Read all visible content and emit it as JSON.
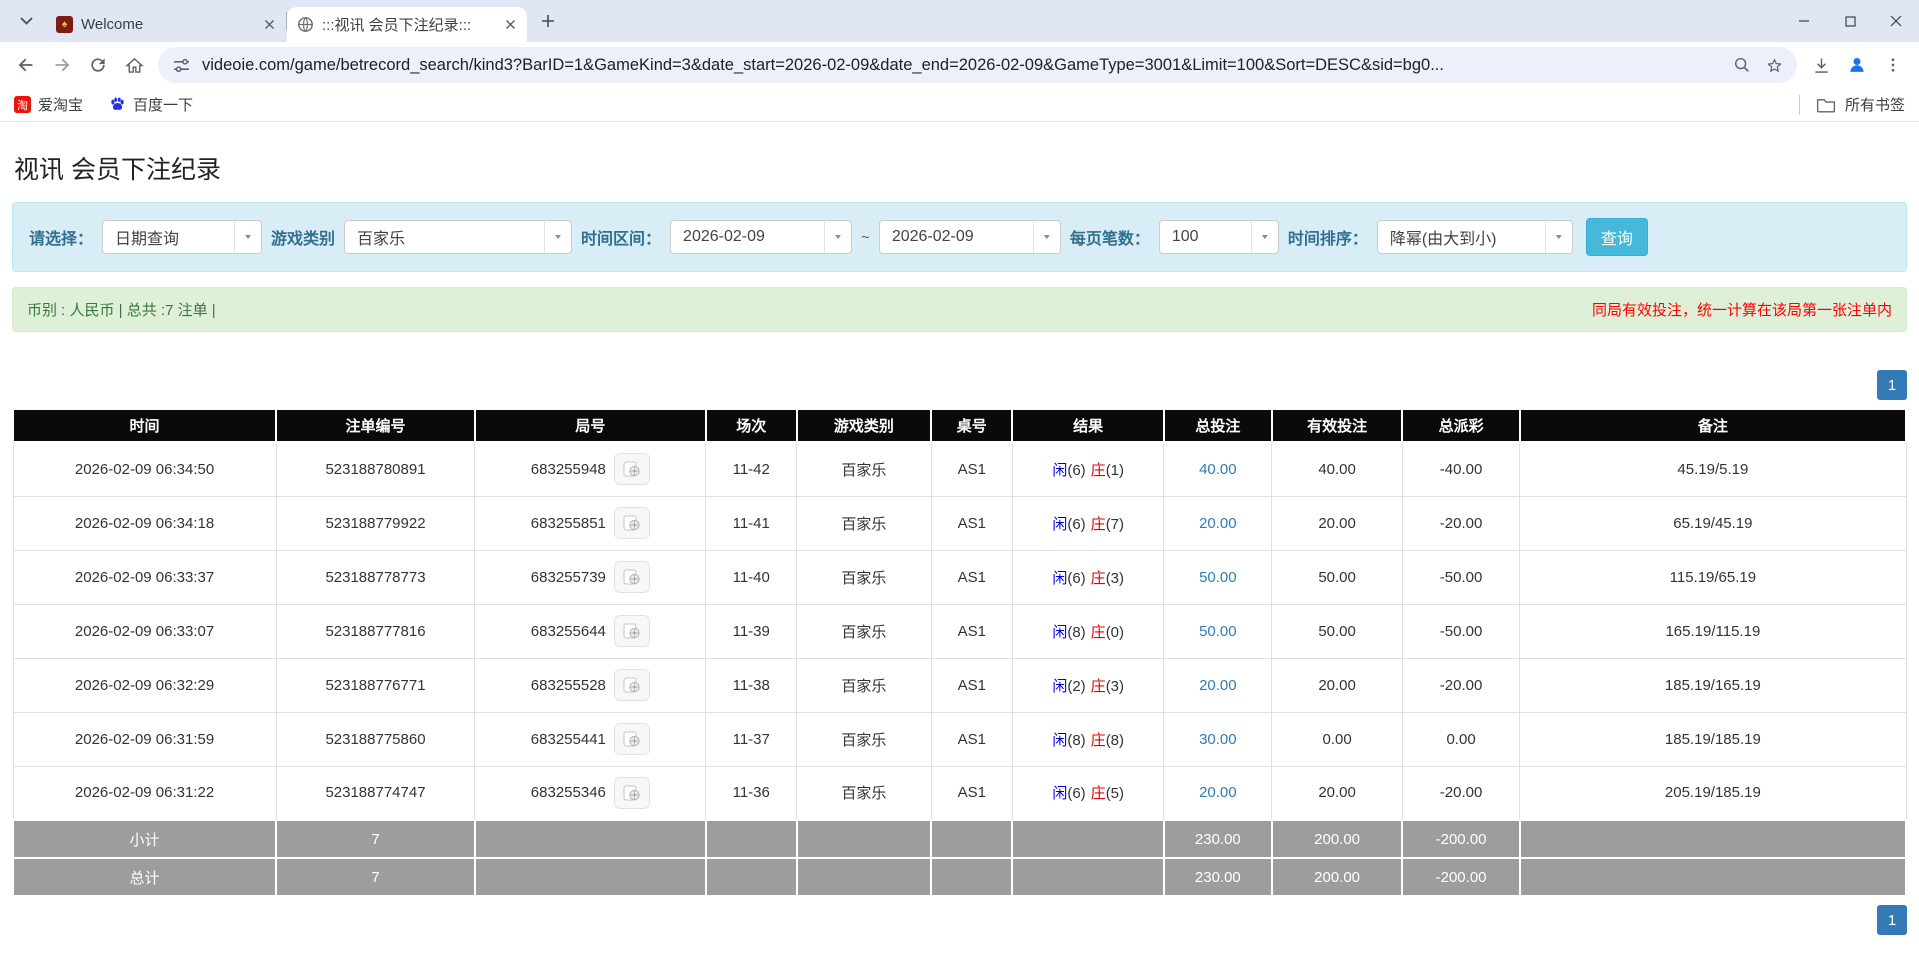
{
  "browser": {
    "tabs": [
      {
        "title": "Welcome"
      },
      {
        "title": ":::视讯 会员下注纪录:::"
      }
    ],
    "url": "videoie.com/game/betrecord_search/kind3?BarID=1&GameKind=3&date_start=2026-02-09&date_end=2026-02-09&GameType=3001&Limit=100&Sort=DESC&sid=bg0...",
    "bookmarks": [
      {
        "label": "爱淘宝"
      },
      {
        "label": "百度一下"
      }
    ],
    "all_bookmarks_label": "所有书签"
  },
  "page": {
    "title": "视讯 会员下注纪录",
    "filters": {
      "query_label": "请选择：",
      "query_value": "日期查询",
      "game_label": "游戏类别",
      "game_value": "百家乐",
      "range_label": "时间区间：",
      "date_start": "2026-02-09",
      "range_sep": "~",
      "date_end": "2026-02-09",
      "per_page_label": "每页笔数：",
      "per_page_value": "100",
      "sort_label": "时间排序：",
      "sort_value": "降幂(由大到小)",
      "search_button": "查询"
    },
    "info_bar": {
      "left": "币别 : 人民币 | 总共 :7 注单 |",
      "right": "同局有效投注，统一计算在该局第一张注单内"
    },
    "pagination": "1",
    "table": {
      "headers": [
        "时间",
        "注单编号",
        "局号",
        "场次",
        "游戏类别",
        "桌号",
        "结果",
        "总投注",
        "有效投注",
        "总派彩",
        "备注"
      ],
      "rows": [
        {
          "time": "2026-02-09 06:34:50",
          "bet_id": "523188780891",
          "round_id": "683255948",
          "session": "11-42",
          "game": "百家乐",
          "table_no": "AS1",
          "player": "闲",
          "player_score": "(6)",
          "banker": "庄",
          "banker_score": "(1)",
          "total_bet": "40.00",
          "valid_bet": "40.00",
          "payout": "-40.00",
          "remark": "45.19/5.19"
        },
        {
          "time": "2026-02-09 06:34:18",
          "bet_id": "523188779922",
          "round_id": "683255851",
          "session": "11-41",
          "game": "百家乐",
          "table_no": "AS1",
          "player": "闲",
          "player_score": "(6)",
          "banker": "庄",
          "banker_score": "(7)",
          "total_bet": "20.00",
          "valid_bet": "20.00",
          "payout": "-20.00",
          "remark": "65.19/45.19"
        },
        {
          "time": "2026-02-09 06:33:37",
          "bet_id": "523188778773",
          "round_id": "683255739",
          "session": "11-40",
          "game": "百家乐",
          "table_no": "AS1",
          "player": "闲",
          "player_score": "(6)",
          "banker": "庄",
          "banker_score": "(3)",
          "total_bet": "50.00",
          "valid_bet": "50.00",
          "payout": "-50.00",
          "remark": "115.19/65.19"
        },
        {
          "time": "2026-02-09 06:33:07",
          "bet_id": "523188777816",
          "round_id": "683255644",
          "session": "11-39",
          "game": "百家乐",
          "table_no": "AS1",
          "player": "闲",
          "player_score": "(8)",
          "banker": "庄",
          "banker_score": "(0)",
          "total_bet": "50.00",
          "valid_bet": "50.00",
          "payout": "-50.00",
          "remark": "165.19/115.19"
        },
        {
          "time": "2026-02-09 06:32:29",
          "bet_id": "523188776771",
          "round_id": "683255528",
          "session": "11-38",
          "game": "百家乐",
          "table_no": "AS1",
          "player": "闲",
          "player_score": "(2)",
          "banker": "庄",
          "banker_score": "(3)",
          "total_bet": "20.00",
          "valid_bet": "20.00",
          "payout": "-20.00",
          "remark": "185.19/165.19"
        },
        {
          "time": "2026-02-09 06:31:59",
          "bet_id": "523188775860",
          "round_id": "683255441",
          "session": "11-37",
          "game": "百家乐",
          "table_no": "AS1",
          "player": "闲",
          "player_score": "(8)",
          "banker": "庄",
          "banker_score": "(8)",
          "total_bet": "30.00",
          "valid_bet": "0.00",
          "payout": "0.00",
          "remark": "185.19/185.19"
        },
        {
          "time": "2026-02-09 06:31:22",
          "bet_id": "523188774747",
          "round_id": "683255346",
          "session": "11-36",
          "game": "百家乐",
          "table_no": "AS1",
          "player": "闲",
          "player_score": "(6)",
          "banker": "庄",
          "banker_score": "(5)",
          "total_bet": "20.00",
          "valid_bet": "20.00",
          "payout": "-20.00",
          "remark": "205.19/185.19"
        }
      ],
      "subtotal": {
        "label": "小计",
        "count": "7",
        "total_bet": "230.00",
        "valid_bet": "200.00",
        "payout": "-200.00"
      },
      "total": {
        "label": "总计",
        "count": "7",
        "total_bet": "230.00",
        "valid_bet": "200.00",
        "payout": "-200.00"
      }
    }
  },
  "colors": {
    "link_blue": "#337ab7",
    "player_blue": "#0000ee",
    "banker_red": "#e60000",
    "negative_red": "#ff0000",
    "header_bg": "#0a0a0a",
    "footer_row_bg": "#9d9d9d",
    "filter_panel_bg": "#d9edf7",
    "filter_label": "#31708f",
    "info_bar_bg": "#dff0d8",
    "info_text_green": "#3c763d",
    "search_button_bg": "#46b8da",
    "pagination_bg": "#337ab7",
    "tab_strip_bg": "#e1e6f4"
  }
}
